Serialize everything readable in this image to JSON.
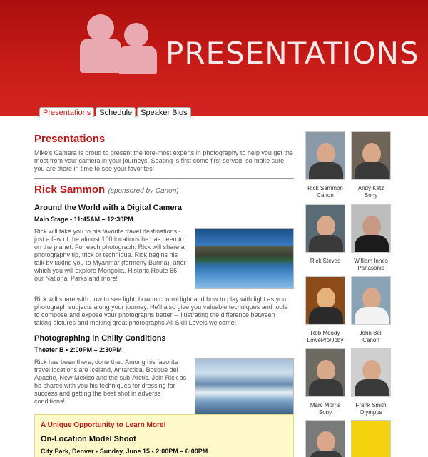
{
  "header": {
    "title": "PRESENTATIONS"
  },
  "tabs": [
    {
      "label": "Presentations",
      "active": true
    },
    {
      "label": "Schedule",
      "active": false
    },
    {
      "label": "Speaker Bios",
      "active": false
    }
  ],
  "main": {
    "title": "Presentations",
    "intro": "Mike's Camera is proud to present the fore-most experts in photography to help you get the most from your camera in your journeys. Seating is first come first served, so make sure you are there in time to see your favorites!",
    "speaker": "Rick Sammon",
    "sponsor": "(sponsored by Canon)",
    "event1": {
      "title": "Around the World with a Digital Camera",
      "time": "Main Stage • 11:45AM – 12:30PM",
      "para1": "Rick will take you to his favorite travel destinations - just a few of the almost 100 locations he has been to on the planet. For each photograph, Rick will share a photography tip, trick or technique. Rick begins his talk by taking you to Myanmar (formerly Burma), after which you will explore Mongolia, Historic Route 66, our National Parks and more!",
      "para2": "Rick will share with how to see light, how to control light and how to play with light as you photograph subjects along your journey. He'll also give you valuable techniques and tools to compose and expose your photographs better – illustrating the difference between taking pictures and making great photographs.All Skill Levels welcome!"
    },
    "event2": {
      "title": "Photographing in Chilly Conditions",
      "time": "Theater B • 2:00PM – 2:30PM",
      "para": "Rick has been there, done that. Among his favorite travel locations are Iceland, Antarctica, Bosque del Apache, New Mexico and the sub-Arctic. Join Rick as he shares with you his techniques for dressing for success and getting the best shot in adverse conditions!"
    }
  },
  "opportunity": {
    "title": "A Unique Opportunity to Learn More!",
    "heading": "On-Location Model Shoot",
    "time": "City Park, Denver • Sunday, June 15 • 2:00PM – 6:00PM"
  },
  "speakers": [
    {
      "name": "Rick Sammon",
      "sponsor": "Canon"
    },
    {
      "name": "Andy Katz",
      "sponsor": "Sony"
    },
    {
      "name": "Rick Steves",
      "sponsor": ""
    },
    {
      "name": "William Innes",
      "sponsor": "Panasonic"
    },
    {
      "name": "Rob Moody",
      "sponsor": "LowePro/Joby"
    },
    {
      "name": "John Bell",
      "sponsor": "Canon"
    },
    {
      "name": "Marc Morris",
      "sponsor": "Sony"
    },
    {
      "name": "Frank Smith",
      "sponsor": "Olympus"
    }
  ]
}
